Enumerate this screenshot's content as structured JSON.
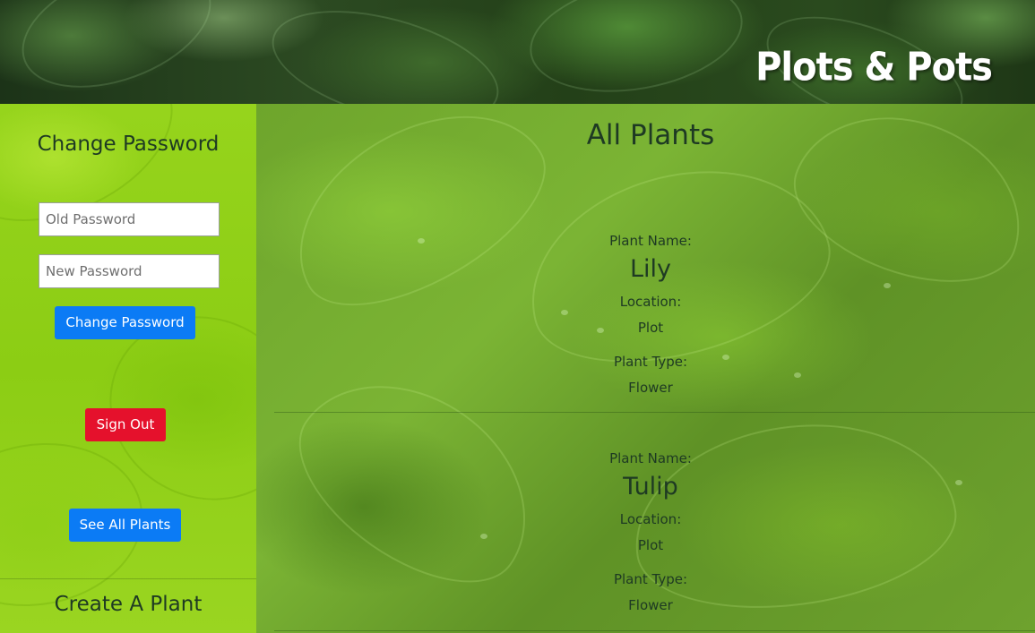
{
  "header": {
    "site_title": "Plots & Pots"
  },
  "sidebar": {
    "change_password": {
      "title": "Change Password",
      "old_password_placeholder": "Old Password",
      "new_password_placeholder": "New Password",
      "submit_label": "Change Password"
    },
    "sign_out_label": "Sign Out",
    "see_all_label": "See All Plants",
    "create_plant_title": "Create A Plant"
  },
  "main": {
    "title": "All Plants",
    "plants": [
      {
        "name_label": "Plant Name:",
        "name": "Lily",
        "location_label": "Location:",
        "location": "Plot",
        "type_label": "Plant Type:",
        "type": "Flower"
      },
      {
        "name_label": "Plant Name:",
        "name": "Tulip",
        "location_label": "Location:",
        "location": "Plot",
        "type_label": "Plant Type:",
        "type": "Flower"
      }
    ]
  },
  "colors": {
    "button_blue": "#0b7bf5",
    "button_red": "#e5112c",
    "sidebar_green": "#8ccd14",
    "text_dark": "#1e3a23"
  }
}
